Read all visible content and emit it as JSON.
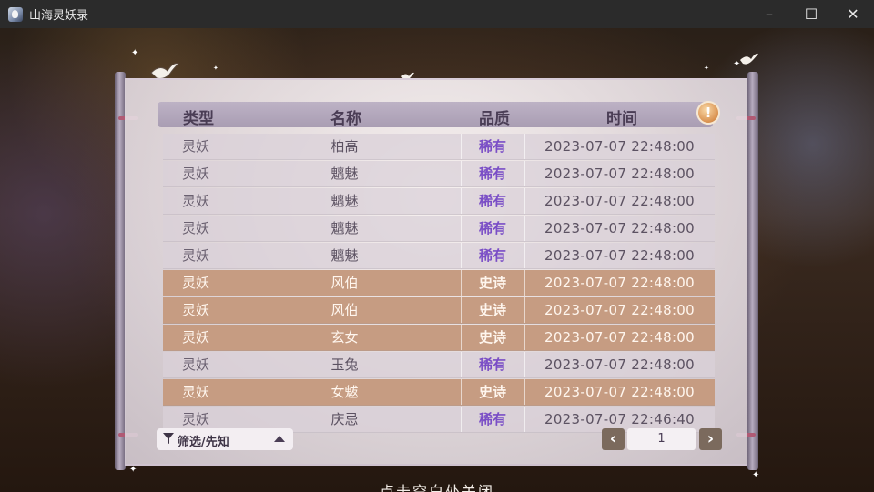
{
  "window": {
    "title": "山海灵妖录",
    "minimize_glyph": "–",
    "maximize_glyph": "☐",
    "close_glyph": "✕"
  },
  "table": {
    "headers": {
      "type": "类型",
      "name": "名称",
      "quality": "品质",
      "time": "时间"
    },
    "rows": [
      {
        "type": "灵妖",
        "name": "柏高",
        "quality": "稀有",
        "time": "2023-07-07  22:48:00",
        "tier": "rare"
      },
      {
        "type": "灵妖",
        "name": "魑魅",
        "quality": "稀有",
        "time": "2023-07-07  22:48:00",
        "tier": "rare"
      },
      {
        "type": "灵妖",
        "name": "魑魅",
        "quality": "稀有",
        "time": "2023-07-07  22:48:00",
        "tier": "rare"
      },
      {
        "type": "灵妖",
        "name": "魑魅",
        "quality": "稀有",
        "time": "2023-07-07  22:48:00",
        "tier": "rare"
      },
      {
        "type": "灵妖",
        "name": "魑魅",
        "quality": "稀有",
        "time": "2023-07-07  22:48:00",
        "tier": "rare"
      },
      {
        "type": "灵妖",
        "name": "风伯",
        "quality": "史诗",
        "time": "2023-07-07  22:48:00",
        "tier": "epic"
      },
      {
        "type": "灵妖",
        "name": "风伯",
        "quality": "史诗",
        "time": "2023-07-07  22:48:00",
        "tier": "epic"
      },
      {
        "type": "灵妖",
        "name": "玄女",
        "quality": "史诗",
        "time": "2023-07-07  22:48:00",
        "tier": "epic"
      },
      {
        "type": "灵妖",
        "name": "玉兔",
        "quality": "稀有",
        "time": "2023-07-07  22:48:00",
        "tier": "rare"
      },
      {
        "type": "灵妖",
        "name": "女魃",
        "quality": "史诗",
        "time": "2023-07-07  22:48:00",
        "tier": "epic"
      },
      {
        "type": "灵妖",
        "name": "庆忌",
        "quality": "稀有",
        "time": "2023-07-07  22:46:40",
        "tier": "rare"
      }
    ]
  },
  "info_button": {
    "glyph": "!"
  },
  "filter": {
    "label": "筛选/先知"
  },
  "pager": {
    "prev_glyph": "‹",
    "next_glyph": "›",
    "page": "1"
  },
  "hint": "点击空白处关闭",
  "colors": {
    "rare_text": "#7a4ec6",
    "epic_row": "#c69c82",
    "header_bg": "#a99db3",
    "titlebar": "#2b2b2b"
  },
  "icons": [
    "app-icon",
    "info-icon",
    "filter-funnel-icon",
    "chevron-left-icon",
    "chevron-right-icon",
    "bird-icon",
    "sparkle-icon"
  ]
}
